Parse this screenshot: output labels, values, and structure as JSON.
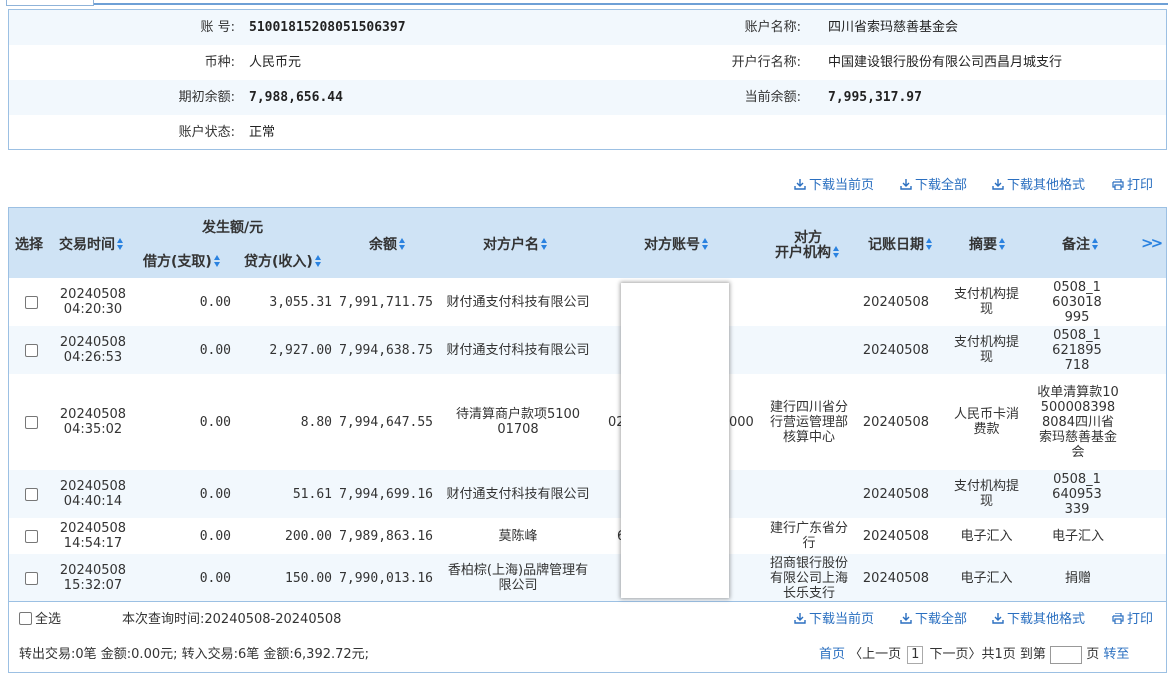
{
  "account": {
    "number_label": "账 号:",
    "number": "51001815208051506397",
    "name_label": "账户名称:",
    "name": "四川省索玛慈善基金会",
    "currency_label": "币种:",
    "currency": "人民币元",
    "bank_label": "开户行名称:",
    "bank": "中国建设银行股份有限公司西昌月城支行",
    "opening_balance_label": "期初余额:",
    "opening_balance": "7,988,656.44",
    "current_balance_label": "当前余额:",
    "current_balance": "7,995,317.97",
    "status_label": "账户状态:",
    "status": "正常"
  },
  "toolbar": {
    "download_page": "下载当前页",
    "download_all": "下载全部",
    "download_other": "下载其他格式",
    "print": "打印"
  },
  "table": {
    "headers": {
      "select": "选择",
      "time": "交易时间",
      "amount_group": "发生额/元",
      "debit": "借方(支取)",
      "credit": "贷方(收入)",
      "balance": "余额",
      "counterparty_name": "对方户名",
      "counterparty_account": "对方账号",
      "counterparty_bank_1": "对方",
      "counterparty_bank_2": "开户机构",
      "post_date": "记账日期",
      "summary": "摘要",
      "remark": "备注"
    },
    "rows": [
      {
        "date": "20240508",
        "time": "04:20:30",
        "debit": "0.00",
        "credit": "3,055.31",
        "balance": "7,991,711.75",
        "name": "财付通支付科技有限公司",
        "account": "",
        "bank": "",
        "post_date": "20240508",
        "summary": "支付机构提现",
        "remark": "0508_1603018995"
      },
      {
        "date": "20240508",
        "time": "04:26:53",
        "debit": "0.00",
        "credit": "2,927.00",
        "balance": "7,994,638.75",
        "name": "财付通支付科技有限公司",
        "account": "",
        "bank": "",
        "post_date": "20240508",
        "summary": "支付机构提现",
        "remark": "0508_1621895718"
      },
      {
        "date": "20240508",
        "time": "04:35:02",
        "debit": "0.00",
        "credit": "8.80",
        "balance": "7,994,647.55",
        "name": "待清算商户款项510001708",
        "account": "02",
        "account_tail": "000",
        "bank": "建行四川省分行营运管理部核算中心",
        "post_date": "20240508",
        "summary": "人民币卡消费款",
        "remark": "收单清算款105000083988084四川省索玛慈善基金会"
      },
      {
        "date": "20240508",
        "time": "04:40:14",
        "debit": "0.00",
        "credit": "51.61",
        "balance": "7,994,699.16",
        "name": "财付通支付科技有限公司",
        "account": "",
        "bank": "",
        "post_date": "20240508",
        "summary": "支付机构提现",
        "remark": "0508_1640953339"
      },
      {
        "date": "20240508",
        "time": "14:54:17",
        "debit": "0.00",
        "credit": "200.00",
        "balance": "7,989,863.16",
        "name": "莫陈峰",
        "account": "6",
        "bank": "建行广东省分行",
        "post_date": "20240508",
        "summary": "电子汇入",
        "remark": "电子汇入"
      },
      {
        "date": "20240508",
        "time": "15:32:07",
        "debit": "0.00",
        "credit": "150.00",
        "balance": "7,990,013.16",
        "name": "香柏棕(上海)品牌管理有限公司",
        "account": "",
        "bank": "招商银行股份有限公司上海长乐支行",
        "post_date": "20240508",
        "summary": "电子汇入",
        "remark": "捐赠"
      }
    ]
  },
  "footer": {
    "select_all": "全选",
    "query_time": "本次查询时间:20240508-20240508",
    "summary": "转出交易:0笔 金额:0.00元; 转入交易:6笔 金额:6,392.72元;",
    "pager": {
      "first": "首页",
      "prev": "〈上一页",
      "current": "1",
      "next": "下一页〉",
      "total": "共1页",
      "goto": "到第",
      "page_unit": "页",
      "go": "转至"
    }
  },
  "icons": {
    "download": "download-icon",
    "print": "printer-icon",
    "sort": "sort-icon",
    "more": "double-chevron-right-icon"
  },
  "colors": {
    "header_bg": "#cfe3f5",
    "border": "#9cc0e3",
    "link": "#2a6fc0",
    "sort": "#2a82e0"
  }
}
